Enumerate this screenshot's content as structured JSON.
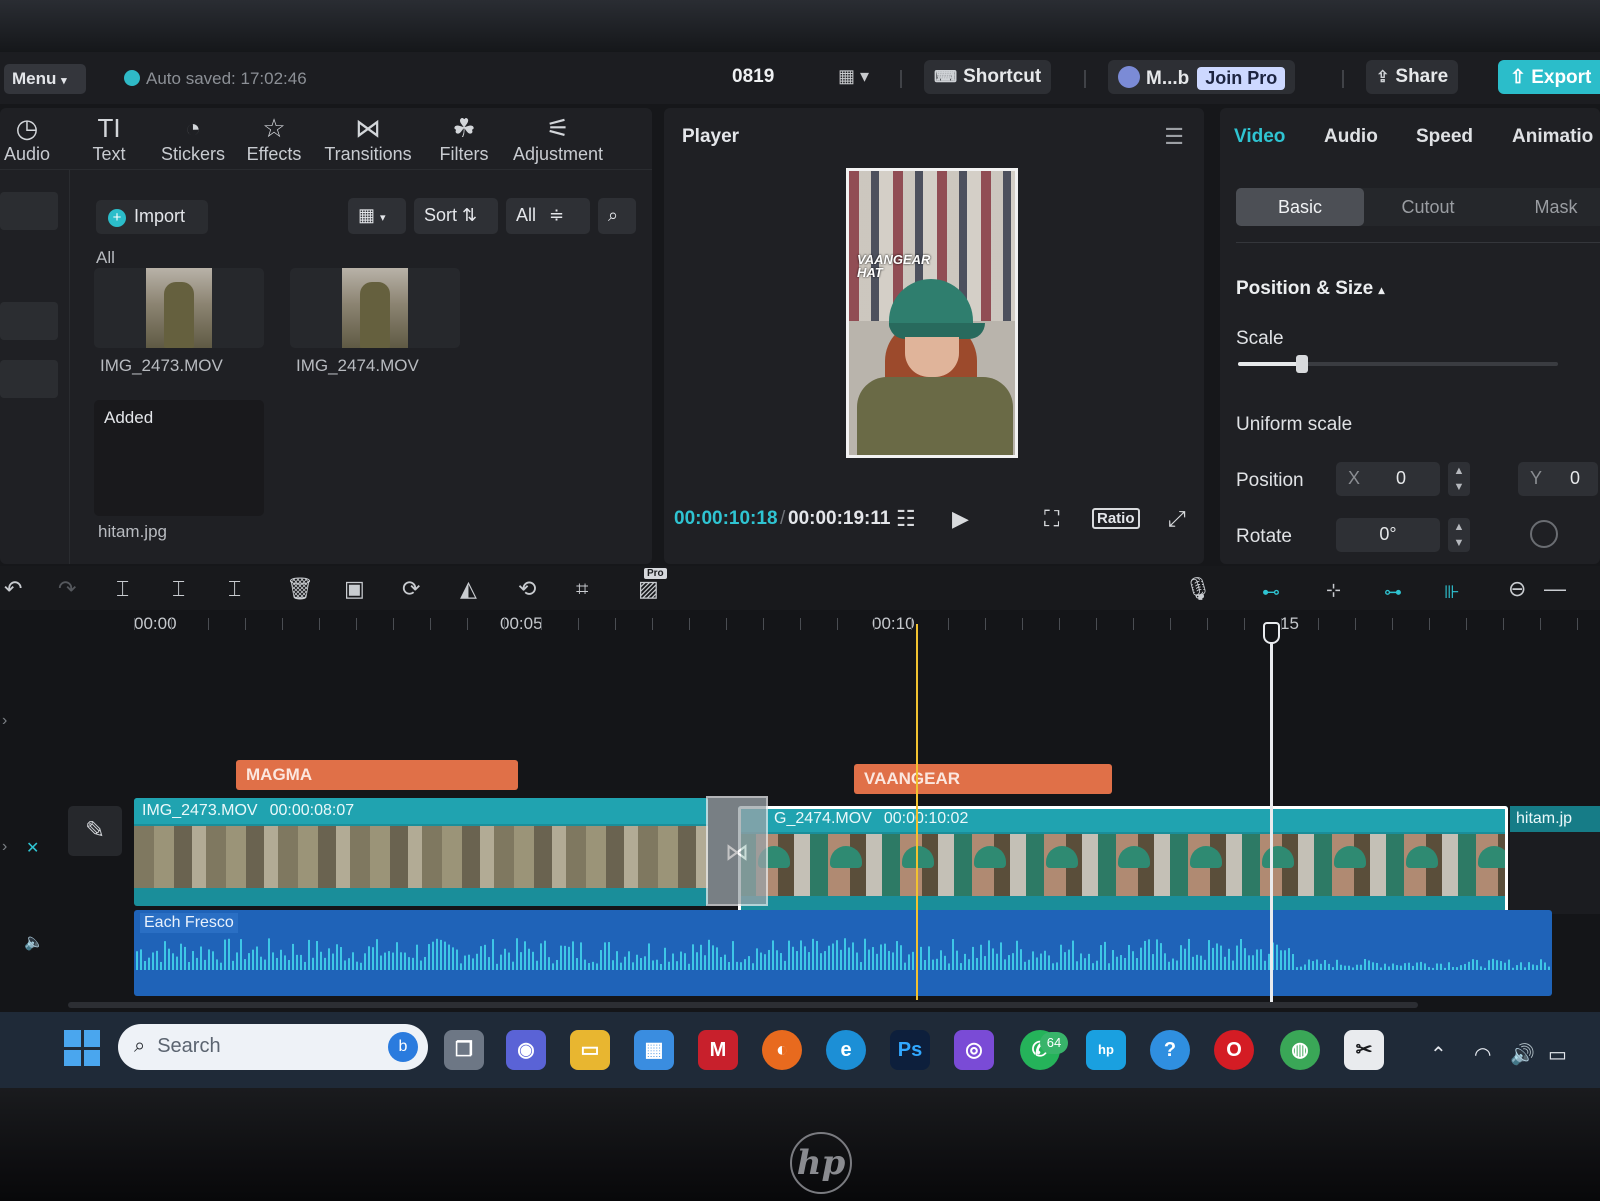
{
  "topbar": {
    "menu_label": "Menu",
    "autosave": "Auto saved: 17:02:46",
    "project_name": "0819",
    "shortcut_label": "Shortcut",
    "user_label": "M...b",
    "join_pro_label": "Join Pro",
    "share_label": "Share",
    "export_label": "Export"
  },
  "tools": [
    {
      "label": "Audio",
      "icon": "audio-icon"
    },
    {
      "label": "Text",
      "icon": "text-icon"
    },
    {
      "label": "Stickers",
      "icon": "stickers-icon"
    },
    {
      "label": "Effects",
      "icon": "effects-icon"
    },
    {
      "label": "Transitions",
      "icon": "transitions-icon"
    },
    {
      "label": "Filters",
      "icon": "filters-icon"
    },
    {
      "label": "Adjustment",
      "icon": "adjustment-icon"
    }
  ],
  "media": {
    "import_label": "Import",
    "sort_label": "Sort",
    "filter_label": "All",
    "section_all": "All",
    "section_added": "Added",
    "items": [
      {
        "name": "IMG_2473.MOV"
      },
      {
        "name": "IMG_2474.MOV"
      }
    ],
    "added_items": [
      {
        "name": "hitam.jpg"
      }
    ]
  },
  "player": {
    "title": "Player",
    "overlay_text_1": "VAANGEAR",
    "overlay_text_2": "HAT",
    "current_time": "00:00:10:18",
    "separator": "/",
    "total_time": "00:00:19:11",
    "ratio_label": "Ratio"
  },
  "inspector": {
    "tabs": [
      "Video",
      "Audio",
      "Speed",
      "Animatio"
    ],
    "active_tab": "Video",
    "subtabs": [
      "Basic",
      "Cutout",
      "Mask"
    ],
    "active_subtab": "Basic",
    "section_title": "Position & Size",
    "scale_label": "Scale",
    "scale_value_fraction": 0.2,
    "uniform_scale_label": "Uniform scale",
    "position_label": "Position",
    "position_x_axis": "X",
    "position_x": "0",
    "position_y_axis": "Y",
    "position_y": "0",
    "rotate_label": "Rotate",
    "rotate_value": "0°"
  },
  "timeline": {
    "ruler_labels": [
      "00:00",
      "00:05",
      "00:10",
      "15"
    ],
    "text_clips": [
      "MAGMA",
      "VAANGEAR"
    ],
    "video_clips": [
      {
        "name": "IMG_2473.MOV",
        "duration": "00:00:08:07"
      },
      {
        "name": "G_2474.MOV",
        "duration": "00:00:10:02"
      }
    ],
    "extra_clip_label": "hitam.jp",
    "audio_clip_label": "Each Fresco"
  },
  "taskbar": {
    "search_placeholder": "Search",
    "whatsapp_badge": "64"
  },
  "colors": {
    "accent": "#2bbdca",
    "text_clip": "#e07048",
    "video_clip": "#1a8e9a",
    "audio_clip": "#1f63b8",
    "playhead": "#f2c230"
  }
}
